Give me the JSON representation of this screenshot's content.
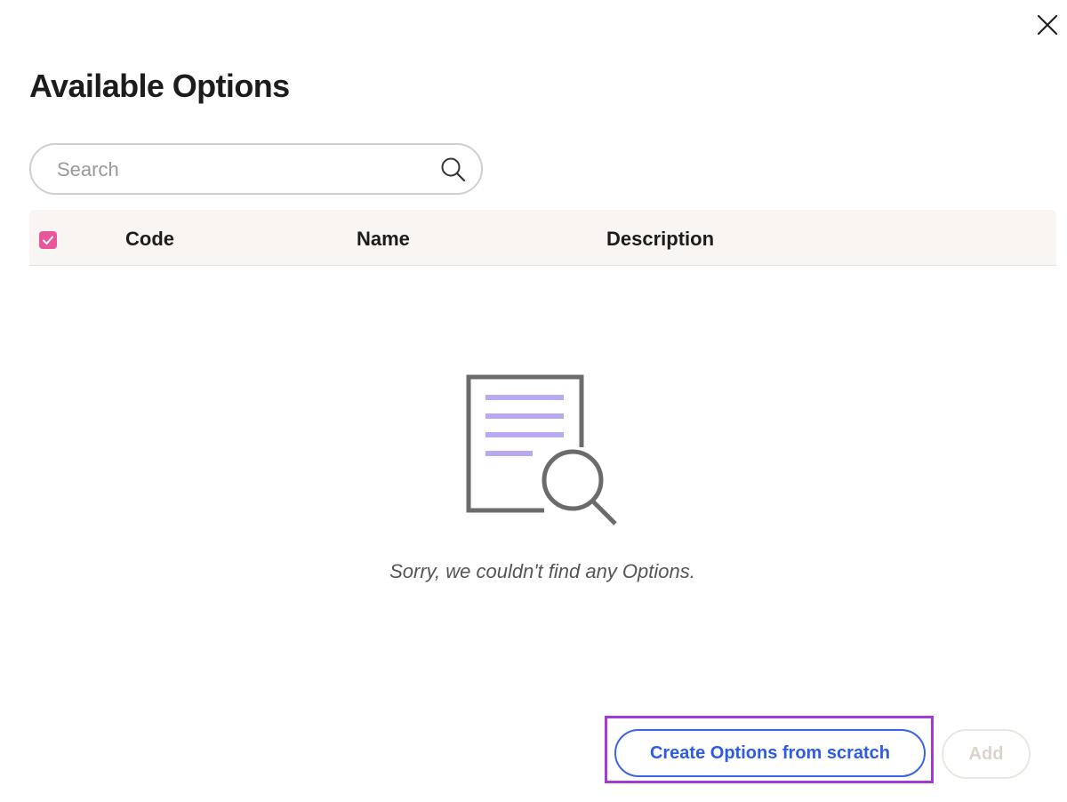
{
  "dialog": {
    "title": "Available Options",
    "close_icon": "close-icon"
  },
  "search": {
    "placeholder": "Search",
    "value": "",
    "icon": "search-icon"
  },
  "table": {
    "select_all_checked": true,
    "columns": [
      "Code",
      "Name",
      "Description"
    ],
    "rows": []
  },
  "empty_state": {
    "icon": "document-search-icon",
    "message": "Sorry, we couldn't find any Options."
  },
  "footer": {
    "create_label": "Create Options from scratch",
    "add_label": "Add",
    "add_disabled": true
  },
  "colors": {
    "accent_blue": "#2d5be3",
    "checkbox_pink": "#e8579a",
    "highlight_purple": "#a43ad6",
    "illustration_lines": "#b8a9f0",
    "header_bg": "#f9f5f2"
  }
}
